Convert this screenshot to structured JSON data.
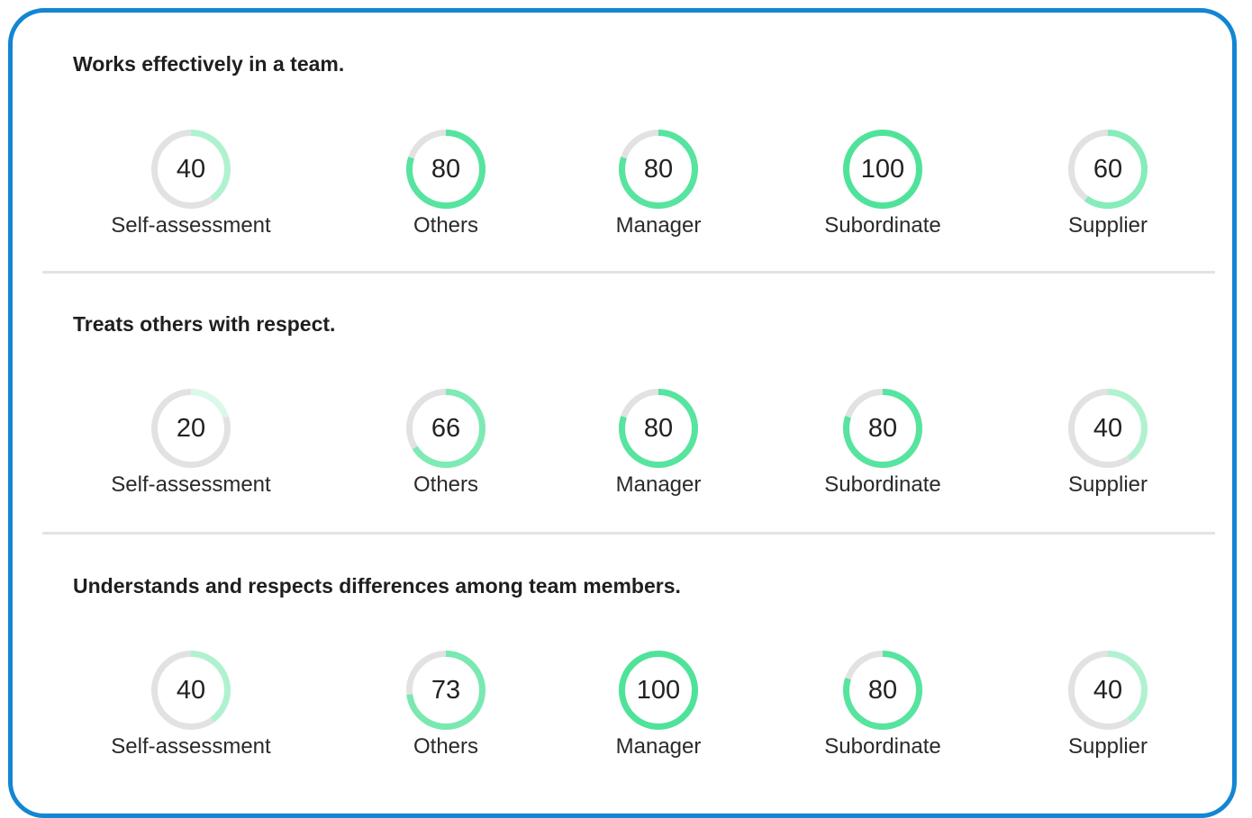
{
  "colors": {
    "border": "#1386d3",
    "track": "#e2e2e2",
    "level_100": "#4fe39a",
    "level_80": "#56e49f",
    "level_73": "#79e9b1",
    "level_66": "#7eeab4",
    "level_60": "#86ecb9",
    "level_40": "#b0f2d0",
    "level_20": "#dbf9e9"
  },
  "sections": [
    {
      "title": "Works effectively in a team.",
      "gauges": [
        {
          "label": "Self-assessment",
          "value": 40,
          "display": "40"
        },
        {
          "label": "Others",
          "value": 80,
          "display": "80"
        },
        {
          "label": "Manager",
          "value": 80,
          "display": "80"
        },
        {
          "label": "Subordinate",
          "value": 100,
          "display": "100"
        },
        {
          "label": "Supplier",
          "value": 60,
          "display": "60"
        }
      ]
    },
    {
      "title": "Treats others with respect.",
      "gauges": [
        {
          "label": "Self-assessment",
          "value": 20,
          "display": "20"
        },
        {
          "label": "Others",
          "value": 66,
          "display": "66"
        },
        {
          "label": "Manager",
          "value": 80,
          "display": "80"
        },
        {
          "label": "Subordinate",
          "value": 80,
          "display": "80"
        },
        {
          "label": "Supplier",
          "value": 40,
          "display": "40"
        }
      ]
    },
    {
      "title": "Understands and respects differences among team members.",
      "gauges": [
        {
          "label": "Self-assessment",
          "value": 40,
          "display": "40"
        },
        {
          "label": "Others",
          "value": 73,
          "display": "73"
        },
        {
          "label": "Manager",
          "value": 100,
          "display": "100"
        },
        {
          "label": "Subordinate",
          "value": 80,
          "display": "80"
        },
        {
          "label": "Supplier",
          "value": 40,
          "display": "40"
        }
      ]
    }
  ]
}
